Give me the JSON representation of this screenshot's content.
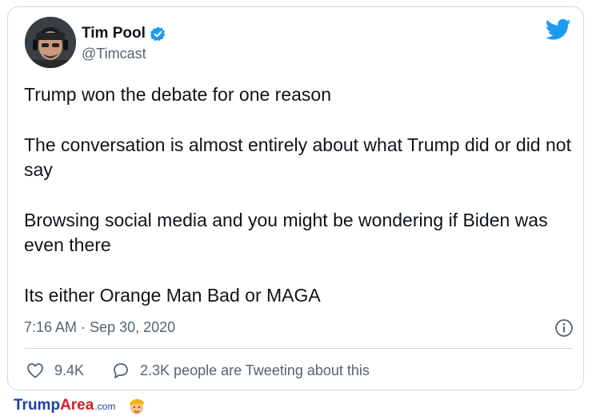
{
  "tweet": {
    "author_name": "Tim Pool",
    "handle": "@Timcast",
    "paragraphs": [
      "Trump won the debate for one reason",
      "The conversation is almost entirely about what Trump did or did not say",
      "Browsing social media and you might be wondering if Biden was even there",
      "Its either Orange Man Bad or MAGA"
    ],
    "timestamp": "7:16 AM · Sep 30, 2020",
    "likes": "9.4K",
    "reply_text": "2.3K people are Tweeting about this"
  },
  "footer": {
    "brand_part1": "Trump",
    "brand_part2": "Area",
    "brand_part3": ".com"
  },
  "colors": {
    "twitter_blue": "#1d9bf0",
    "text_primary": "#0f1419",
    "text_secondary": "#536471",
    "border": "#cfd9de"
  },
  "icons": [
    "verified-badge-icon",
    "twitter-bird-icon",
    "info-icon",
    "heart-icon",
    "reply-bubble-icon",
    "mascot-icon"
  ]
}
